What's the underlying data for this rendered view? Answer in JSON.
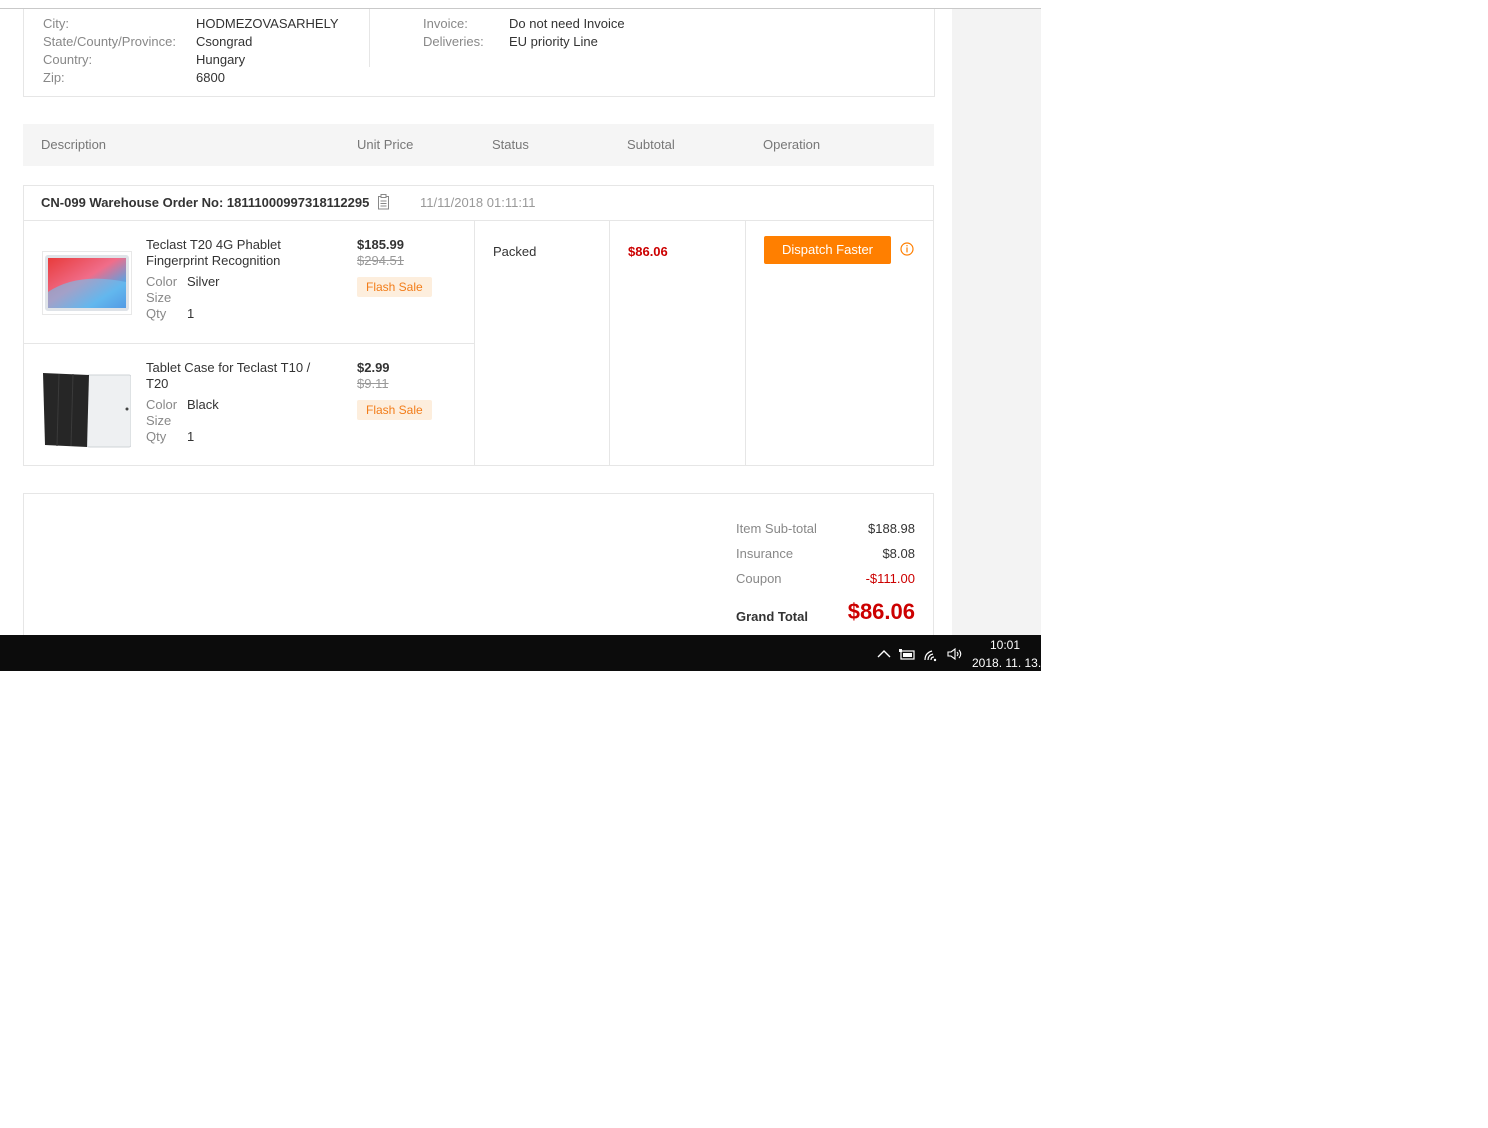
{
  "address": {
    "city_label": "City:",
    "city": "HODMEZOVASARHELY",
    "state_label": "State/County/Province:",
    "state": "Csongrad",
    "country_label": "Country:",
    "country": "Hungary",
    "zip_label": "Zip:",
    "zip": "6800",
    "invoice_label": "Invoice:",
    "invoice": "Do not need Invoice",
    "deliveries_label": "Deliveries:",
    "deliveries": "EU priority Line"
  },
  "table_header": {
    "description": "Description",
    "unit_price": "Unit Price",
    "status": "Status",
    "subtotal": "Subtotal",
    "operation": "Operation"
  },
  "order": {
    "number": "CN-099 Warehouse Order No: 18111000997318112295",
    "date": "11/11/2018 01:11:11",
    "status": "Packed",
    "subtotal": "$86.06",
    "dispatch_label": "Dispatch Faster",
    "items": [
      {
        "title": "Teclast T20 4G Phablet Fingerprint Recognition",
        "color_label": "Color",
        "color": "Silver",
        "size_label": "Size",
        "qty_label": "Qty",
        "qty": "1",
        "price": "$185.99",
        "old_price": "$294.51",
        "badge": "Flash Sale"
      },
      {
        "title": "Tablet Case for Teclast T10 / T20",
        "color_label": "Color",
        "color": "Black",
        "size_label": "Size",
        "qty_label": "Qty",
        "qty": "1",
        "price": "$2.99",
        "old_price": "$9.11",
        "badge": "Flash Sale"
      }
    ]
  },
  "totals": {
    "item_subtotal_label": "Item Sub-total",
    "item_subtotal": "$188.98",
    "insurance_label": "Insurance",
    "insurance": "$8.08",
    "coupon_label": "Coupon",
    "coupon": "-$111.00",
    "grand_total_label": "Grand Total",
    "grand_total": "$86.06"
  },
  "colors": {
    "accent_orange": "#ff7f00",
    "price_red": "#cc0000",
    "flash_bg": "#fdeedd"
  },
  "taskbar": {
    "time": "10:01",
    "date": "2018. 11. 13.",
    "icons": [
      "chevron-up-icon",
      "battery-icon",
      "wifi-icon",
      "volume-icon"
    ]
  }
}
